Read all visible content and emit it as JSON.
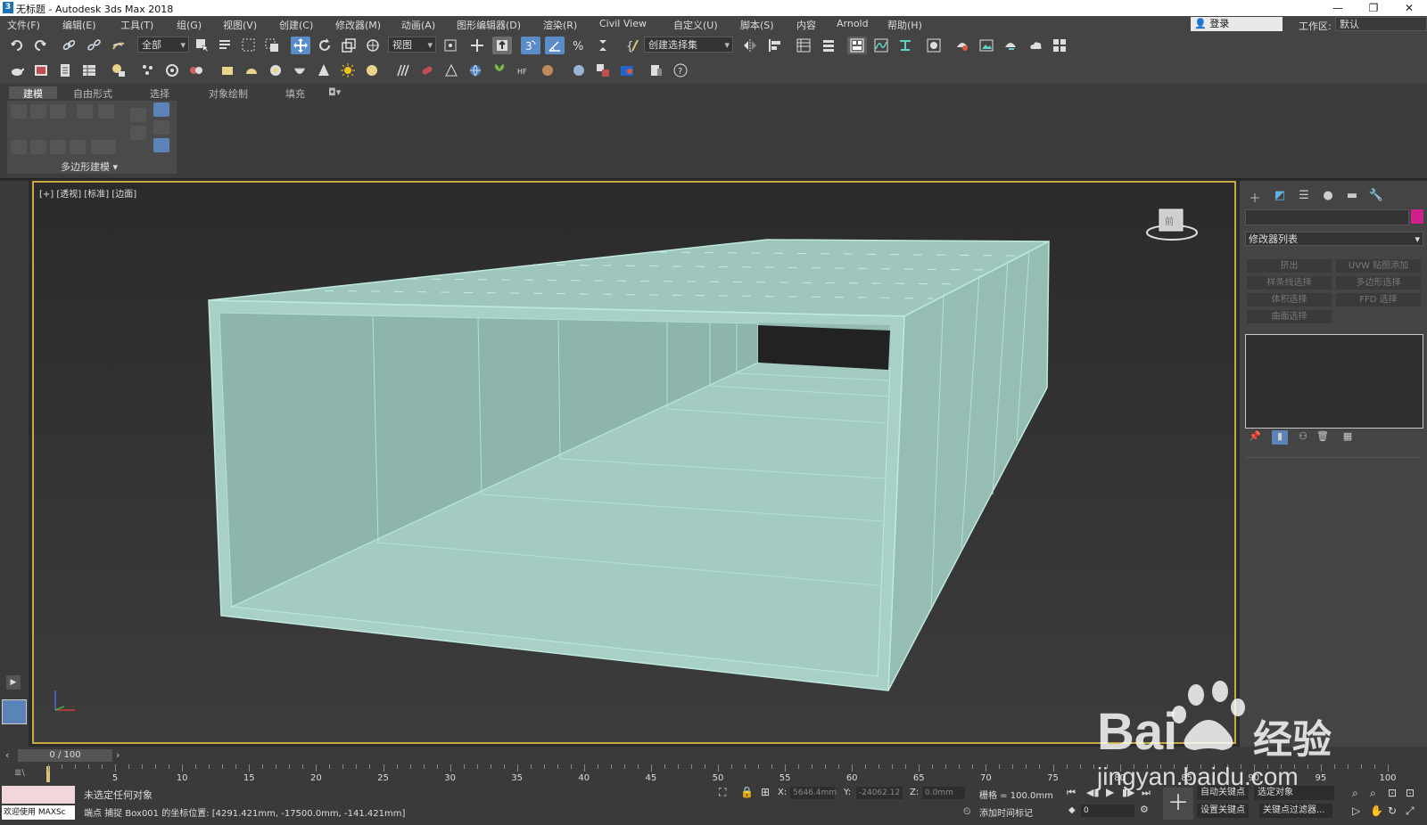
{
  "window": {
    "title": "无标题 - Autodesk 3ds Max 2018",
    "logo": "3",
    "controls": [
      "—",
      "❐",
      "✕"
    ]
  },
  "menubar": {
    "items": [
      "文件(F)",
      "编辑(E)",
      "工具(T)",
      "组(G)",
      "视图(V)",
      "创建(C)",
      "修改器(M)",
      "动画(A)",
      "图形编辑器(D)",
      "渲染(R)",
      "Civil View",
      "自定义(U)",
      "脚本(S)",
      "内容",
      "Arnold",
      "帮助(H)"
    ],
    "login": "登录",
    "workspace_label": "工作区:",
    "workspace_value": "默认"
  },
  "toolbar": {
    "selection_filter": "全部",
    "reference_coord": "视图",
    "named_selection": "创建选择集"
  },
  "ribbon": {
    "tabs": [
      "建模",
      "自由形式",
      "选择",
      "对象绘制",
      "填充"
    ],
    "panel_label": "多边形建模 ▾"
  },
  "viewport": {
    "label": "[+] [透视] [标准] [边面]",
    "mesh_color": "#9fc6bd",
    "edge_color": "#bfe9df",
    "border_color": "#c9a942"
  },
  "command_panel": {
    "modifier_list": "修改器列表",
    "modifier_buttons": [
      "挤出",
      "UVW 贴图添加",
      "样条线选择",
      "多边形选择",
      "体积选择",
      "FFD 选择",
      "曲面选择"
    ]
  },
  "timeline": {
    "slider": "0 / 100",
    "ticks": [
      "0",
      "5",
      "10",
      "15",
      "20",
      "25",
      "30",
      "35",
      "40",
      "45",
      "50",
      "55",
      "60",
      "65",
      "70",
      "75",
      "80",
      "85",
      "90",
      "95",
      "100"
    ]
  },
  "status": {
    "welcome": "欢迎使用 MAXSc",
    "selection": "未选定任何对象",
    "prompt": "端点 捕捉 Box001 的坐标位置: [4291.421mm, -17500.0mm, -141.421mm]",
    "x_label": "X:",
    "x_value": "5646.4mm",
    "y_label": "Y:",
    "y_value": "-24062.12",
    "z_label": "Z:",
    "z_value": "0.0mm",
    "grid": "栅格 = 100.0mm",
    "add_time_tag": "添加时间标记",
    "auto_key": "自动关键点",
    "set_key": "设置关键点",
    "key_mode": "选定对象",
    "key_filter": "关键点过滤器...",
    "frame": "0"
  },
  "watermark": {
    "text_main": "Bai",
    "text_cn": "经验",
    "url": "jingyan.baidu.com"
  }
}
